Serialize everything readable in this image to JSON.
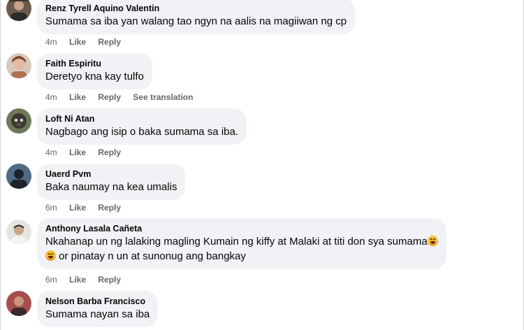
{
  "comments": [
    {
      "author": "Renz Tyrell Aquino Valentin",
      "lines": [
        "Sumama sa iba yan walang tao ngyn na aalis na magiiwan ng cp"
      ],
      "time": "4m",
      "like": "Like",
      "reply": "Reply",
      "avatar_icon": "person-photo-avatar"
    },
    {
      "author": "Faith Espiritu",
      "lines": [
        "Deretyo kna kay tulfo"
      ],
      "time": "4m",
      "like": "Like",
      "reply": "Reply",
      "translate": "See translation",
      "avatar_icon": "person-photo-avatar"
    },
    {
      "author": "Loft Ni Atan",
      "lines": [
        "Nagbago ang isip o baka sumama sa iba."
      ],
      "time": "4m",
      "like": "Like",
      "reply": "Reply",
      "avatar_icon": "monkey-photo-avatar"
    },
    {
      "author": "Uaerd Pvm",
      "lines": [
        "Baka naumay na kea umalis"
      ],
      "time": "6m",
      "like": "Like",
      "reply": "Reply",
      "avatar_icon": "silhouette-photo-avatar"
    },
    {
      "author": "Anthony Lasala Cañeta",
      "lines": [
        "Nkahanap un ng lalaking magling Kumain ng kiffy at Malaki at titi don sya sumama",
        "or pinatay n un at sunonug ang bangkay"
      ],
      "time": "6m",
      "like": "Like",
      "reply": "Reply",
      "avatar_icon": "person-photo-avatar",
      "emoji_icon": "rolling-laughing-emoji-icon"
    },
    {
      "author": "Nelson Barba Francisco",
      "lines": [
        "Sumama nayan sa iba"
      ],
      "time": "6m",
      "like": "Like",
      "reply": "Reply",
      "avatar_icon": "person-photo-avatar"
    }
  ],
  "colors": {
    "bubble": "#f0f2f5",
    "secondary_text": "#65676b",
    "primary_text": "#050505",
    "emoji": "#f7c13a"
  }
}
